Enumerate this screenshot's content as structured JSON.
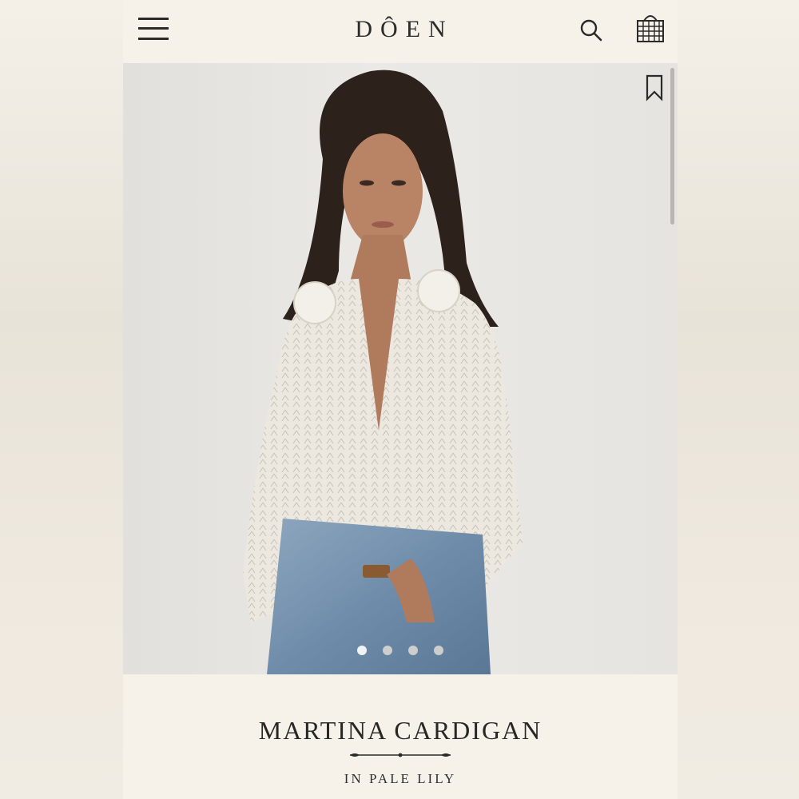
{
  "header": {
    "logo": "DÔEN",
    "menu_icon": "hamburger-menu-icon",
    "search_icon": "search-icon",
    "cart_icon": "basket-icon"
  },
  "gallery": {
    "image_description": "model-wearing-cardigan-photo",
    "bookmark_icon": "bookmark-icon",
    "slides": [
      "1",
      "2",
      "3",
      "4"
    ],
    "active_slide": 1
  },
  "product": {
    "title": "MARTINA CARDIGAN",
    "color_line": "IN PALE LILY"
  },
  "colors": {
    "background": "#f6f2ea",
    "text": "#272725",
    "photo_bg": "#e6e4e0"
  }
}
